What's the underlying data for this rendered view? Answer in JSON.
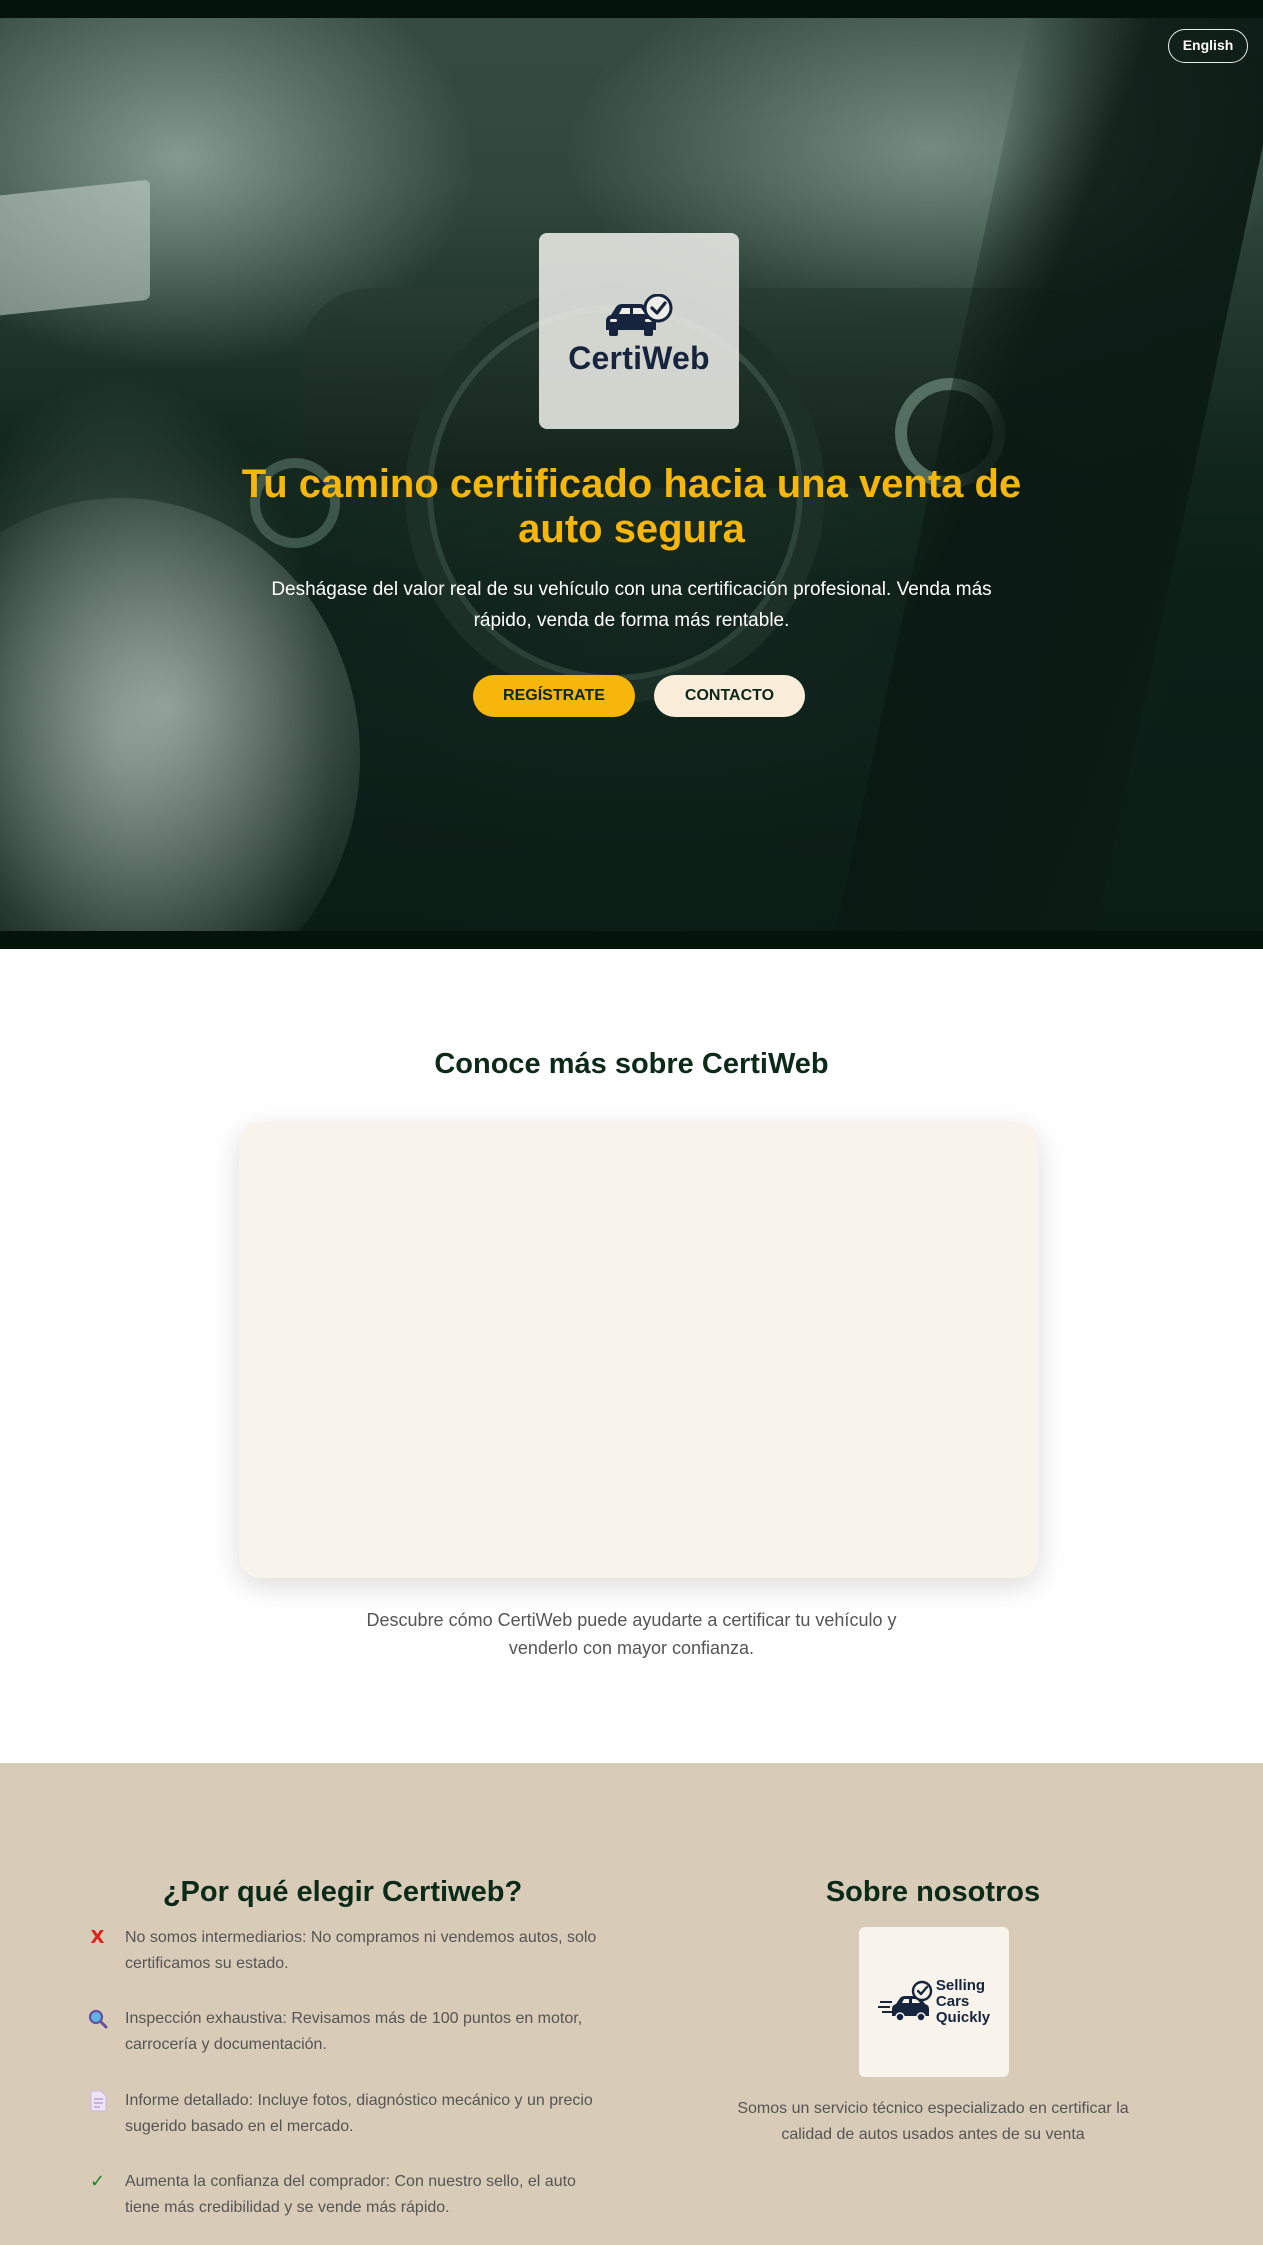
{
  "language_toggle": {
    "label": "English"
  },
  "hero": {
    "logo_text": "CertiWeb",
    "title": "Tu camino certificado hacia una venta de auto segura",
    "subtitle": "Deshágase del valor real de su vehículo con una certificación profesional. Venda más rápido, venda de forma más rentable.",
    "buttons": {
      "register": "REGÍSTRATE",
      "contact": "CONTACTO"
    }
  },
  "learn_more": {
    "title": "Conoce más sobre CertiWeb",
    "description": "Descubre cómo CertiWeb puede ayudarte a certificar tu vehículo y venderlo con mayor confianza."
  },
  "why": {
    "title": "¿Por qué elegir Certiweb?",
    "features": [
      {
        "icon": "cross-icon",
        "text": "No somos intermediarios: No compramos ni vendemos autos, solo certificamos su estado."
      },
      {
        "icon": "magnifier-icon",
        "text": "Inspección exhaustiva: Revisamos más de 100 puntos en motor, carrocería y documentación."
      },
      {
        "icon": "document-icon",
        "text": "Informe detallado: Incluye fotos, diagnóstico mecánico y un precio sugerido basado en el mercado."
      },
      {
        "icon": "checkmark-icon",
        "text": "Aumenta la confianza del comprador: Con nuestro sello, el auto tiene más credibilidad y se vende más rápido."
      }
    ]
  },
  "about": {
    "title": "Sobre nosotros",
    "logo_lines": [
      "Selling",
      "Cars",
      "Quickly"
    ],
    "description": "Somos un servicio técnico especializado en certificar la calidad de autos usados antes de su venta"
  },
  "colors": {
    "accent_yellow": "#f6b60c",
    "dark_green": "#0c2a18",
    "beige_section": "#d8cbb7",
    "cream": "#f8f4ec",
    "navy_logo": "#16243d"
  }
}
